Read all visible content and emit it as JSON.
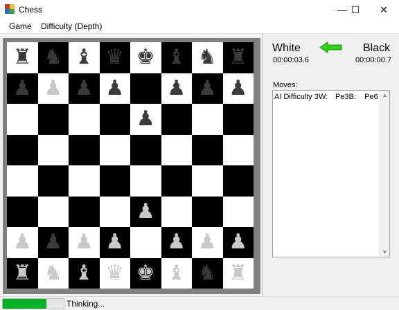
{
  "window": {
    "title": "Chess",
    "controls": {
      "minimize": "—",
      "maximize": "☐",
      "close": "✕"
    }
  },
  "menu": {
    "items": [
      {
        "label": "Game"
      },
      {
        "label": "Difficulty (Depth)"
      }
    ]
  },
  "board": {
    "rows": [
      [
        "bR",
        "bN",
        "bB",
        "bQ",
        "bK",
        "bB",
        "bN",
        "bR"
      ],
      [
        "bP",
        "wP",
        "bP",
        "bP",
        "",
        "bP",
        "bP",
        "bP"
      ],
      [
        "",
        "",
        "",
        "",
        "bP",
        "",
        "",
        ""
      ],
      [
        "",
        "",
        "",
        "",
        "",
        "",
        "",
        ""
      ],
      [
        "",
        "",
        "",
        "",
        "",
        "",
        "",
        ""
      ],
      [
        "",
        "",
        "",
        "",
        "wP",
        "",
        "",
        ""
      ],
      [
        "wP",
        "bP",
        "wP",
        "wP",
        "",
        "wP",
        "wP",
        "wP"
      ],
      [
        "wR",
        "wN",
        "wB",
        "wQ",
        "wK",
        "wB",
        "bN",
        "wR"
      ]
    ]
  },
  "players": {
    "white": {
      "name": "White",
      "time": "00:00:03.6"
    },
    "black": {
      "name": "Black",
      "time": "00:00:00.7"
    },
    "turn_indicator": "arrow-pointing-to-white"
  },
  "moves": {
    "label": "Moves:",
    "entries": [
      {
        "player": "AI Difficulty 3W:",
        "white": "Pe3B:",
        "black": "Pe6"
      }
    ]
  },
  "status": {
    "text": "Thinking...",
    "progress": 0.72,
    "progress_color": "#06b025"
  },
  "colors": {
    "dark_square": "#000000",
    "light_square": "#ffffff",
    "arrow": "#33d11a"
  }
}
